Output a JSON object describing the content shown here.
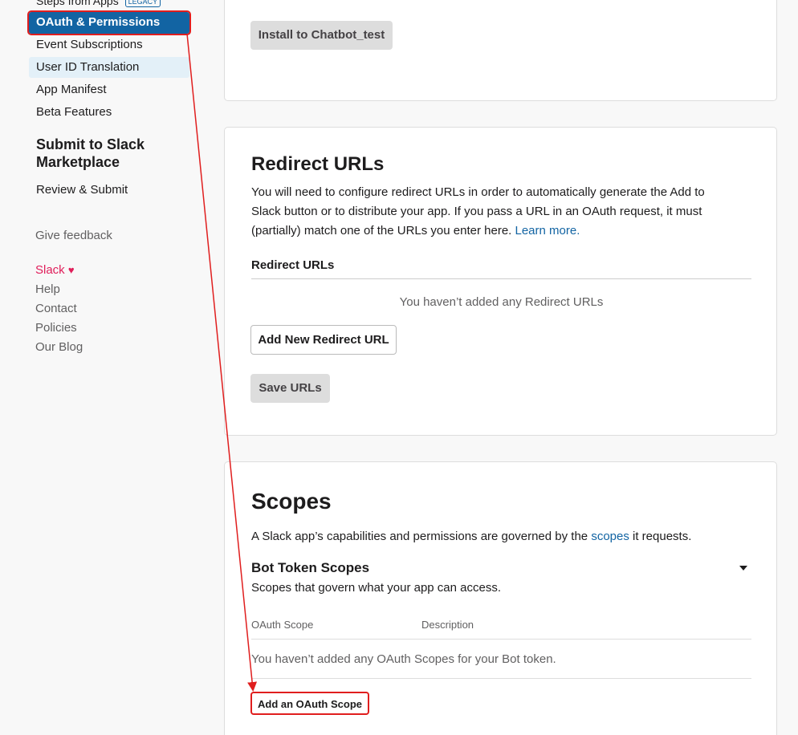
{
  "sidebar": {
    "top_item": "Steps from Apps",
    "legacy_badge": "LEGACY",
    "items": [
      {
        "label": "OAuth & Permissions"
      },
      {
        "label": "Event Subscriptions"
      },
      {
        "label": "User ID Translation"
      },
      {
        "label": "App Manifest"
      },
      {
        "label": "Beta Features"
      }
    ],
    "section_title": "Submit to Slack Marketplace",
    "review_label": "Review & Submit",
    "feedback_label": "Give feedback",
    "footer_links": [
      {
        "label": "Slack"
      },
      {
        "label": "Help"
      },
      {
        "label": "Contact"
      },
      {
        "label": "Policies"
      },
      {
        "label": "Our Blog"
      }
    ]
  },
  "install": {
    "button_label": "Install to Chatbot_test"
  },
  "redirect": {
    "title": "Redirect URLs",
    "description_1": "You will need to configure redirect URLs in order to automatically generate the Add to",
    "description_2": "Slack button or to distribute your app. If you pass a URL in an OAuth request, it must",
    "description_3": "(partially) match one of the URLs you enter here. ",
    "learn_more": "Learn more.",
    "subheading": "Redirect URLs",
    "empty_text": "You haven’t added any Redirect URLs",
    "add_button": "Add New Redirect URL",
    "save_button": "Save URLs"
  },
  "scopes": {
    "title": "Scopes",
    "description_pre": "A Slack app’s capabilities and permissions are governed by the ",
    "description_link": "scopes",
    "description_post": " it requests.",
    "bot_title": "Bot Token Scopes",
    "bot_description": "Scopes that govern what your app can access.",
    "col_scope": "OAuth Scope",
    "col_description": "Description",
    "empty_text": "You haven’t added any OAuth Scopes for your Bot token.",
    "add_button": "Add an OAuth Scope"
  },
  "colors": {
    "accent": "#1264a3",
    "annotation": "#e01e1e",
    "slack_pink": "#e01e5a"
  }
}
